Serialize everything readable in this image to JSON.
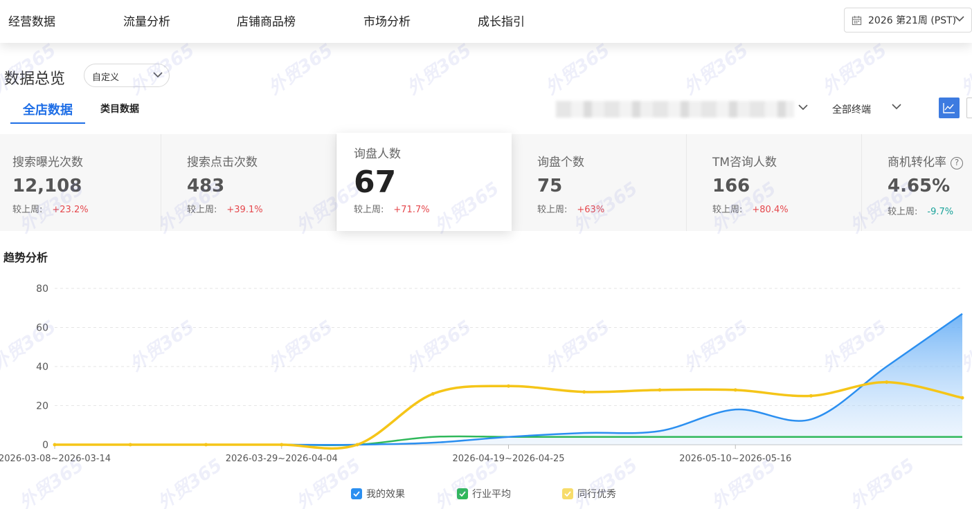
{
  "nav": {
    "items": [
      "经营数据",
      "流量分析",
      "店铺商品榜",
      "市场分析",
      "成长指引"
    ],
    "date_range": "2026 第21周 (PST)"
  },
  "overview": {
    "title": "数据总览",
    "period_select": "自定义",
    "tabs": [
      "全店数据",
      "类目数据"
    ],
    "terminal_select": "全部终端"
  },
  "kpis": [
    {
      "label": "搜索曝光次数",
      "value": "12,108",
      "compare_label": "较上周:",
      "change": "+23.2%",
      "trend": "up"
    },
    {
      "label": "搜索点击次数",
      "value": "483",
      "compare_label": "较上周:",
      "change": "+39.1%",
      "trend": "up"
    },
    {
      "label": "询盘人数",
      "value": "67",
      "compare_label": "较上周:",
      "change": "+71.7%",
      "trend": "up"
    },
    {
      "label": "询盘个数",
      "value": "75",
      "compare_label": "较上周:",
      "change": "+63%",
      "trend": "up"
    },
    {
      "label": "TM咨询人数",
      "value": "166",
      "compare_label": "较上周:",
      "change": "+80.4%",
      "trend": "up"
    },
    {
      "label": "商机转化率",
      "value": "4.65%",
      "compare_label": "较上周:",
      "change": "-9.7%",
      "trend": "down"
    }
  ],
  "colors": {
    "accent": "#1e6ee6",
    "up": "#e5484d",
    "down": "#1aa39a",
    "series_mine": "#2b8ff0",
    "series_industry": "#2fb85a",
    "series_peer": "#f5c518"
  },
  "trend": {
    "title": "趋势分析",
    "legend": [
      "我的效果",
      "行业平均",
      "同行优秀"
    ]
  },
  "watermark_text": "外贸365",
  "chart_data": {
    "type": "line",
    "title": "",
    "ylim": [
      0,
      80
    ],
    "yticks": [
      0,
      20,
      40,
      60,
      80
    ],
    "grid": true,
    "x_tick_labels": [
      "2026-03-08~2026-03-14",
      "2026-03-29~2026-04-04",
      "2026-04-19~2026-04-25",
      "2026-05-10~2026-05-16"
    ],
    "x_tick_index": [
      0,
      3,
      6,
      9
    ],
    "x_count": 12,
    "series": [
      {
        "name": "我的效果",
        "values": [
          0,
          0,
          0,
          0,
          0,
          1,
          4,
          6,
          7,
          18,
          13,
          40,
          67
        ]
      },
      {
        "name": "行业平均",
        "values": [
          0,
          0,
          0,
          0,
          0,
          4,
          4,
          4,
          4,
          4,
          4,
          4,
          4
        ]
      },
      {
        "name": "同行优秀",
        "values": [
          0,
          0,
          0,
          0,
          0,
          26,
          30,
          27,
          28,
          28,
          25,
          32,
          24
        ]
      }
    ]
  }
}
